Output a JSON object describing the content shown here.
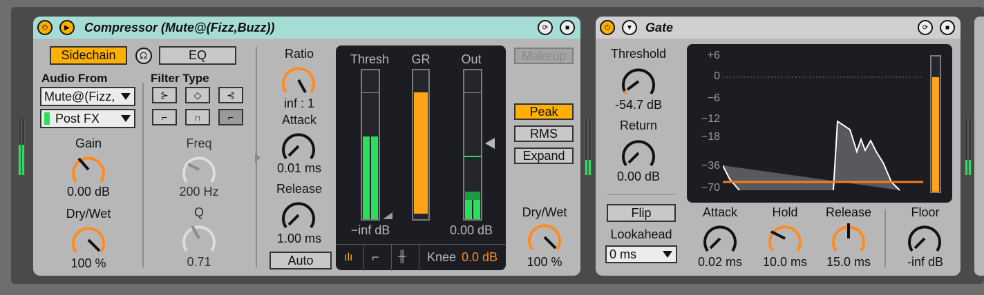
{
  "compressor": {
    "title": "Compressor (Mute@(Fizz,Buzz))",
    "sidechain_label": "Sidechain",
    "eq_label": "EQ",
    "audio_from_label": "Audio From",
    "audio_from_value": "Mute@(Fizz,",
    "post_fx_value": "Post FX",
    "filter_type_label": "Filter Type",
    "gain_label": "Gain",
    "gain_value": "0.00 dB",
    "gain_level": 0.5,
    "drywet_left_label": "Dry/Wet",
    "drywet_left_value": "100 %",
    "freq_label": "Freq",
    "freq_value": "200 Hz",
    "q_label": "Q",
    "q_value": "0.71",
    "ratio_label": "Ratio",
    "ratio_value": "inf : 1",
    "attack_label": "Attack",
    "attack_value": "0.01 ms",
    "release_label": "Release",
    "release_value": "1.00 ms",
    "auto_label": "Auto",
    "thresh_label": "Thresh",
    "gr_label": "GR",
    "out_label": "Out",
    "thresh_readout": "−inf dB",
    "out_readout": "0.00 dB",
    "knee_label": "Knee",
    "knee_value": "0.0 dB",
    "makeup_label": "Makeup",
    "peak_label": "Peak",
    "rms_label": "RMS",
    "expand_label": "Expand",
    "drywet_right_label": "Dry/Wet",
    "drywet_right_value": "100 %",
    "colors": {
      "title_bar": "#a6dcd6",
      "accent": "#ff8a1e",
      "meter_green": "#2bde5b",
      "meter_orange": "#ffa418",
      "active": "#ffb000"
    }
  },
  "gate": {
    "title": "Gate",
    "threshold_label": "Threshold",
    "threshold_value": "-54.7 dB",
    "return_label": "Return",
    "return_value": "0.00 dB",
    "flip_label": "Flip",
    "lookahead_label": "Lookahead",
    "lookahead_value": "0 ms",
    "attack_label": "Attack",
    "attack_value": "0.02 ms",
    "hold_label": "Hold",
    "hold_value": "10.0 ms",
    "release_label": "Release",
    "release_value": "15.0 ms",
    "floor_label": "Floor",
    "floor_value": "-inf dB",
    "scale": [
      "+6",
      "0",
      "−6",
      "−12",
      "−18",
      "−36",
      "−70"
    ],
    "colors": {
      "title_bar": "#cfcfcf",
      "accent": "#ff8a1e"
    }
  }
}
